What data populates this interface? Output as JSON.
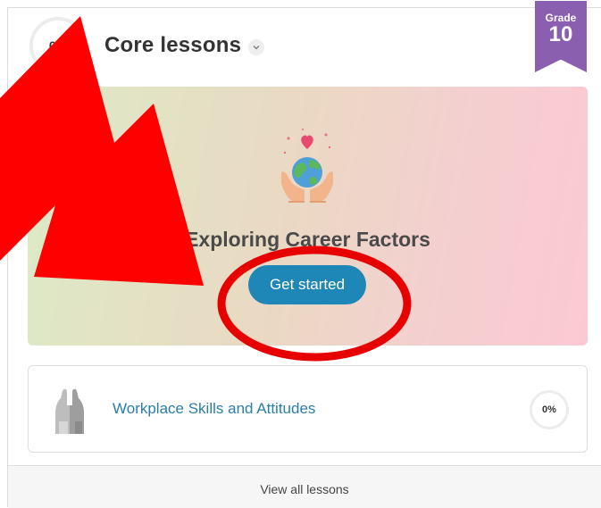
{
  "header": {
    "progress": "0%",
    "title": "Core lessons",
    "grade_label": "Grade",
    "grade_number": "10"
  },
  "featured_lesson": {
    "title": "Exploring Career Factors",
    "button_label": "Get started",
    "icon": "hands-holding-earth-heart-icon"
  },
  "lessons": [
    {
      "title": "Workplace Skills and Attitudes",
      "progress": "0%",
      "icon": "high-five-hands-icon"
    }
  ],
  "footer": {
    "link_label": "View all lessons"
  },
  "colors": {
    "accent": "#1f86b8",
    "grade_ribbon": "#8b5fb0",
    "link": "#2a7fa6",
    "annotation_red": "#ff0000"
  }
}
